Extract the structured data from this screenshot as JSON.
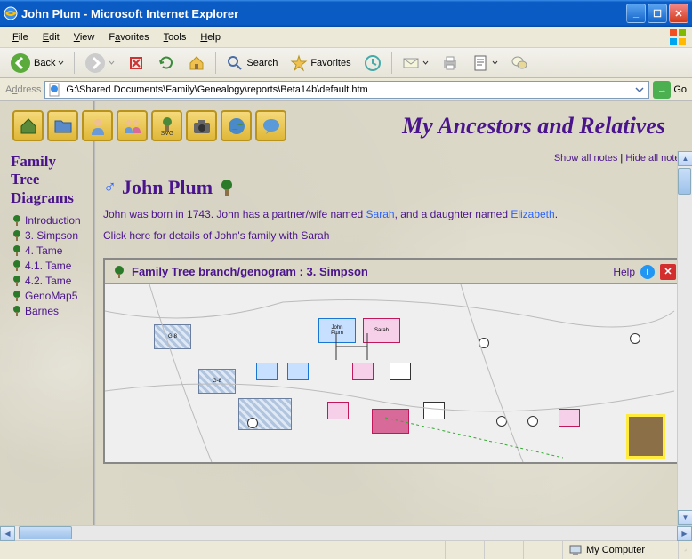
{
  "window": {
    "title": "John Plum - Microsoft Internet Explorer"
  },
  "menu": {
    "file": "File",
    "edit": "Edit",
    "view": "View",
    "favorites": "Favorites",
    "tools": "Tools",
    "help": "Help"
  },
  "toolbar": {
    "back": "Back",
    "search": "Search",
    "favorites": "Favorites"
  },
  "address": {
    "label": "Address",
    "value": "G:\\Shared Documents\\Family\\Genealogy\\reports\\Beta14b\\default.htm",
    "go": "Go"
  },
  "app": {
    "title": "My Ancestors and Relatives"
  },
  "sidebar": {
    "heading": "Family Tree Diagrams",
    "items": [
      {
        "label": "Introduction"
      },
      {
        "label": "3. Simpson"
      },
      {
        "label": "4. Tame"
      },
      {
        "label": "4.1. Tame"
      },
      {
        "label": "4.2. Tame"
      },
      {
        "label": "GenoMap5"
      },
      {
        "label": "Barnes"
      }
    ]
  },
  "notes": {
    "show": "Show all notes",
    "sep": " | ",
    "hide": "Hide all notes"
  },
  "person": {
    "name": "John Plum",
    "bio_1": "John was born in 1743.  John has a partner/wife named ",
    "bio_link1": "Sarah",
    "bio_2": ", and a daughter named ",
    "bio_link2": "Elizabeth",
    "bio_3": ".",
    "family_link": "Click here for details of John's family with Sarah"
  },
  "geno": {
    "title": "Family Tree branch/genogram : 3. Simpson",
    "help": "Help"
  },
  "status": {
    "zone": "My Computer"
  }
}
